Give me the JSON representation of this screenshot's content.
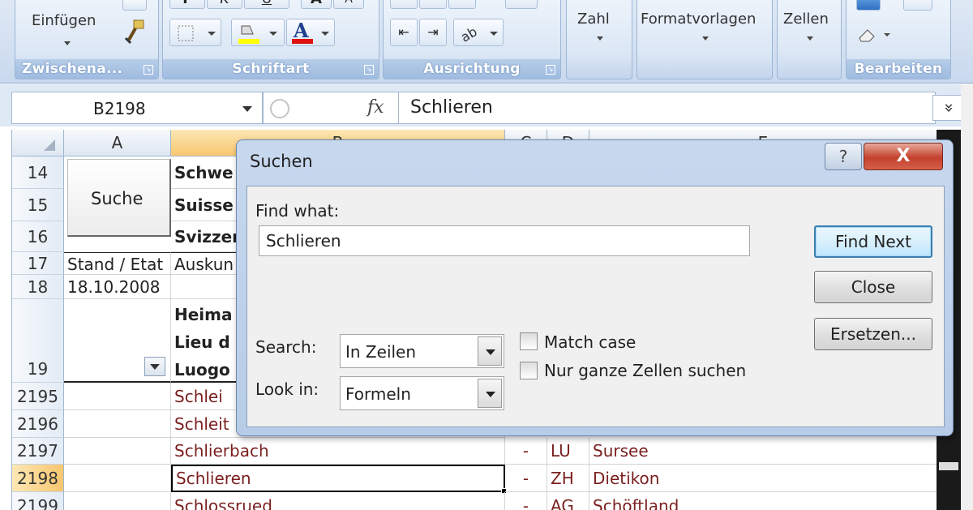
{
  "ribbon": {
    "clipboard": {
      "paste_label": "Einfügen",
      "group_label": "Zwischena..."
    },
    "font": {
      "group_label": "Schriftart"
    },
    "alignment": {
      "group_label": "Ausrichtung"
    },
    "number": {
      "label": "Zahl"
    },
    "styles": {
      "label": "Formatvorlagen"
    },
    "cells": {
      "label": "Zellen"
    },
    "editing": {
      "group_label": "Bearbeiten"
    }
  },
  "formula_bar": {
    "name_box": "B2198",
    "fx": "fx",
    "formula": "Schlieren",
    "expand": "»"
  },
  "sheet": {
    "columns": [
      "A",
      "B",
      "C",
      "D",
      "E"
    ],
    "search_button": "Suche",
    "rows": {
      "r14": {
        "num": "14",
        "b": "Schwe"
      },
      "r15": {
        "num": "15",
        "b": "Suisse"
      },
      "r16": {
        "num": "16",
        "b": "Svizzer"
      },
      "r17": {
        "num": "17",
        "a": "Stand / Etat",
        "b": "Auskun"
      },
      "r18": {
        "num": "18",
        "a": "18.10.2008"
      },
      "r19": {
        "num": "19",
        "b1": "Heima",
        "b2": "Lieu d",
        "b3": "Luogo"
      },
      "r2195": {
        "num": "2195",
        "b": "Schlei"
      },
      "r2196": {
        "num": "2196",
        "b": "Schleit"
      },
      "r2197": {
        "num": "2197",
        "b": "Schlierbach",
        "c": "-",
        "d": "LU",
        "e": "Sursee"
      },
      "r2198": {
        "num": "2198",
        "b": "Schlieren",
        "c": "-",
        "d": "ZH",
        "e": "Dietikon"
      },
      "r2199": {
        "num": "2199",
        "b": "Schlossrued",
        "c": "-",
        "d": "AG",
        "e": "Schöftland"
      }
    }
  },
  "dialog": {
    "title": "Suchen",
    "help": "?",
    "close": "X",
    "find_label": "Find what:",
    "find_value": "Schlieren",
    "search_label": "Search:",
    "search_value": "In Zeilen",
    "lookin_label": "Look in:",
    "lookin_value": "Formeln",
    "match_case": "Match case",
    "whole_cells": "Nur ganze Zellen suchen",
    "find_next": "Find Next",
    "close_button": "Close",
    "replace_button": "Ersetzen..."
  }
}
